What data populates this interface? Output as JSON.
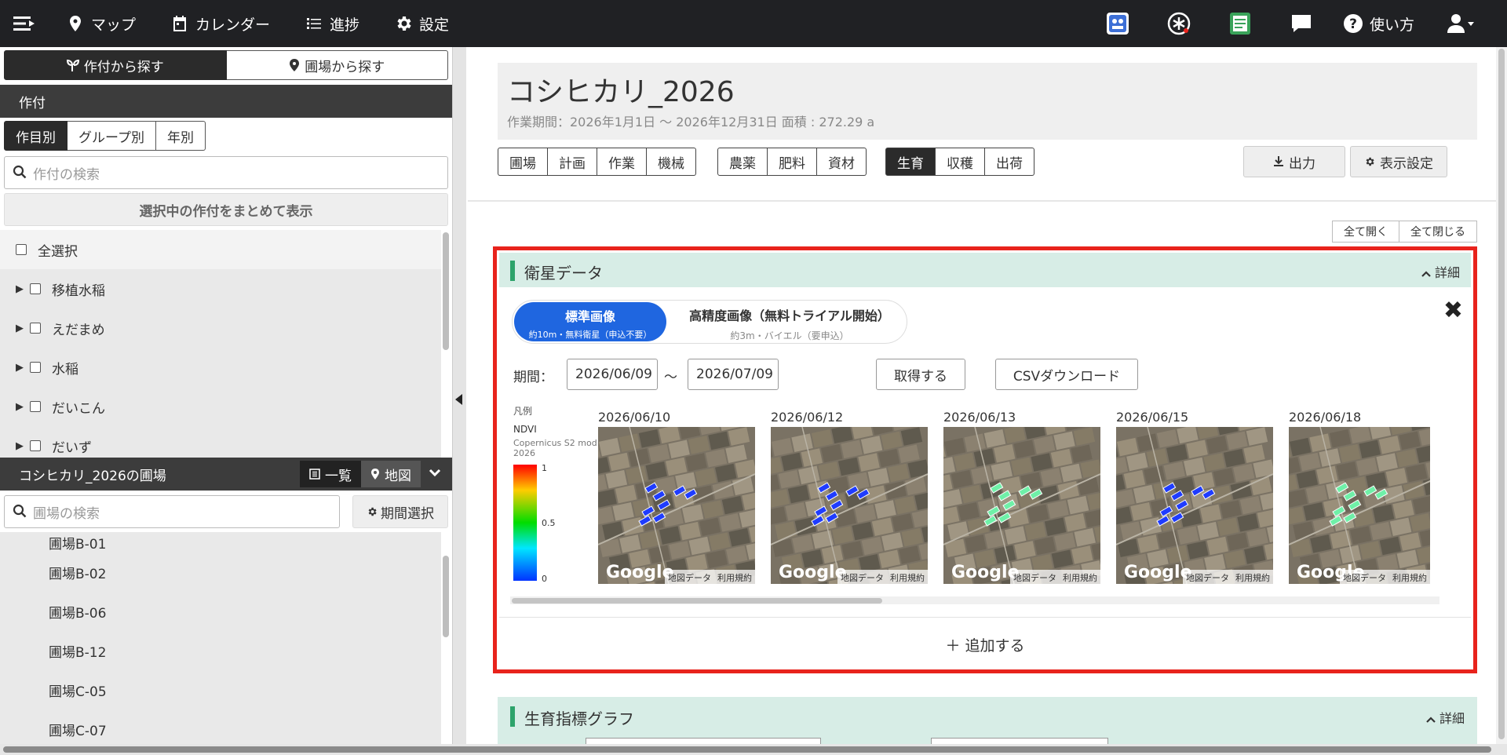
{
  "nav": {
    "items": [
      {
        "label": "マップ",
        "icon": "map-pin-icon"
      },
      {
        "label": "カレンダー",
        "icon": "calendar-icon"
      },
      {
        "label": "進捗",
        "icon": "progress-list-icon"
      },
      {
        "label": "設定",
        "icon": "gear-icon"
      }
    ],
    "help_label": "使い方",
    "right_icons": [
      "mgr-app-icon",
      "asterisk-tool-icon",
      "report-app-icon",
      "chat-icon",
      "help-icon",
      "user-menu-icon"
    ]
  },
  "left": {
    "search_mode": {
      "by_crop": "作付から探す",
      "by_field": "圃場から探す"
    },
    "crop_section_title": "作付",
    "crop_tabs": [
      "作目別",
      "グループ別",
      "年別"
    ],
    "crop_search_placeholder": "作付の検索",
    "show_selected_label": "選択中の作付をまとめて表示",
    "select_all_label": "全選択",
    "crops": [
      "移植水稲",
      "えだまめ",
      "水稲",
      "だいこん",
      "だいず"
    ],
    "field_section_title": "コシヒカリ_2026の圃場",
    "view_list_label": "一覧",
    "view_map_label": "地図",
    "field_search_placeholder": "圃場の検索",
    "period_select_label": "期間選択",
    "fields": [
      "圃場B-01",
      "圃場B-02",
      "圃場B-06",
      "圃場B-12",
      "圃場C-05",
      "圃場C-07"
    ]
  },
  "main": {
    "title": "コシヒカリ_2026",
    "subtitle": "作業期間：2026年1月1日 〜 2026年12月31日  面積 : 272.29 a",
    "tab_groups": [
      [
        "圃場",
        "計画",
        "作業",
        "機械"
      ],
      [
        "農薬",
        "肥料",
        "資材"
      ],
      [
        "生育",
        "収穫",
        "出荷"
      ]
    ],
    "active_tab": "生育",
    "export_label": "出力",
    "display_settings_label": "表示設定",
    "expand_all": "全て開く",
    "collapse_all": "全て閉じる",
    "satellite": {
      "title": "衛星データ",
      "detail_label": "詳細",
      "standard": {
        "label": "標準画像",
        "sub": "約10m・無料衛星（申込不要）"
      },
      "high_res": {
        "label": "高精度画像（無料トライアル開始）",
        "sub": "約3m・バイエル（要申込）"
      },
      "period_label": "期間：",
      "date_from": "2026/06/09",
      "tilde": "〜",
      "date_to": "2026/07/09",
      "fetch_label": "取得する",
      "csv_label": "CSVダウンロード",
      "legend": {
        "title": "凡例",
        "index": "NDVI",
        "source": "Copernicus S2 mod 2026",
        "max": "1",
        "mid": "0.5",
        "min": "0",
        "colors": [
          "#ff0000",
          "#ffcc00",
          "#00dd00",
          "#00e6ff",
          "#0033ff"
        ]
      },
      "images": [
        {
          "date": "2026/06/10",
          "tone": "blue"
        },
        {
          "date": "2026/06/12",
          "tone": "blue"
        },
        {
          "date": "2026/06/13",
          "tone": "green"
        },
        {
          "date": "2026/06/15",
          "tone": "blue"
        },
        {
          "date": "2026/06/18",
          "tone": "green"
        }
      ],
      "google_mark": "Google",
      "map_data_label": "地図データ",
      "terms_label": "利用規約",
      "add_label": "＋  追加する"
    },
    "growth_graph": {
      "title": "生育指標グラフ",
      "detail_label": "詳細"
    }
  },
  "colors": {
    "nav_bg": "#202124",
    "accent_blue": "#1f66e0",
    "highlight_red": "#e8231c",
    "card_header_bg": "#d7ede6",
    "card_header_bar": "#2da36b"
  }
}
